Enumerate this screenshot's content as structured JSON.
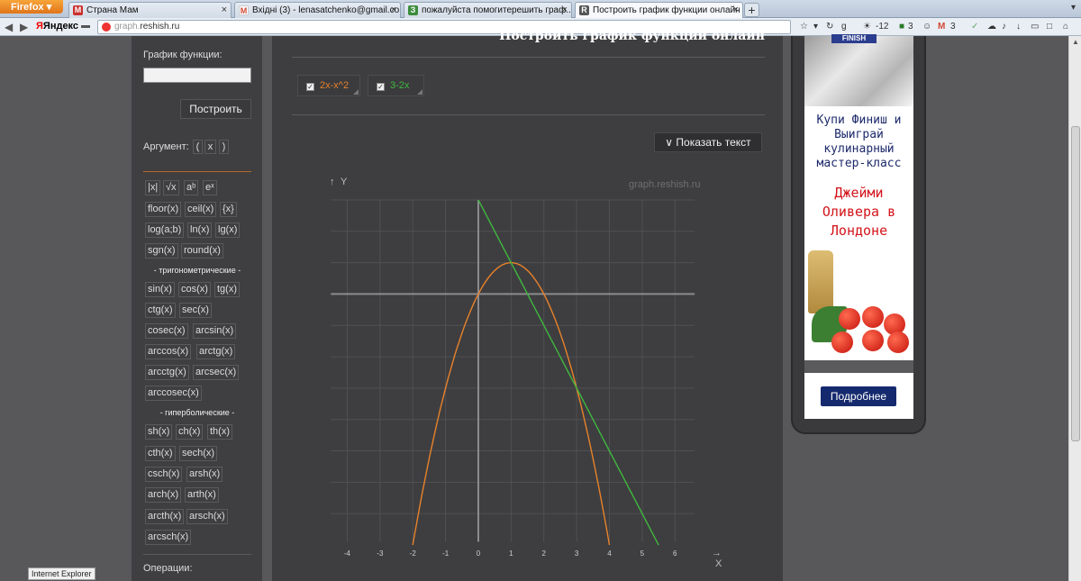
{
  "browser": {
    "menu_button": "Firefox",
    "tabs": [
      {
        "title": "Страна Мам",
        "icon": "М",
        "color": "#c9302c"
      },
      {
        "title": "Вхідні (3) - lenasatchenko@gmail.co...",
        "icon": "M",
        "color": "#d14836"
      },
      {
        "title": "пожалуйста помогитерешить граф...",
        "icon": "З",
        "color": "#3b8c3b"
      },
      {
        "title": "Построить график функции онлайн",
        "icon": "R",
        "color": "#555555"
      }
    ],
    "search_engine": "Яндекс",
    "url_prefix": "graph.",
    "url_host": "reshish.ru",
    "toolbar": {
      "weather": "-12",
      "count1": "3",
      "count2": "3"
    },
    "status_text": "Internet Explorer"
  },
  "sidebar": {
    "function_label": "График функции:",
    "build_button": "Построить",
    "argument_label": "Аргумент:",
    "arg_buttons": [
      "(",
      "x",
      ")"
    ],
    "trig_label": "- тригонометрические -",
    "hyper_label": "- гиперболические -",
    "operations_label": "Операции:",
    "basic": [
      "|x|",
      "√x",
      "aᵇ",
      "eˣ",
      "floor(x)",
      "ceil(x)",
      "{x}",
      "log(a;b)",
      "ln(x)",
      "lg(x)",
      "sgn(x)",
      "round(x)"
    ],
    "trig": [
      "sin(x)",
      "cos(x)",
      "tg(x)",
      "ctg(x)",
      "sec(x)",
      "cosec(x)",
      "arcsin(x)",
      "arccos(x)",
      "arctg(x)",
      "arcctg(x)",
      "arcsec(x)",
      "arccosec(x)"
    ],
    "hyper": [
      "sh(x)",
      "ch(x)",
      "th(x)",
      "cth(x)",
      "sech(x)",
      "csch(x)",
      "arsh(x)",
      "arch(x)",
      "arth(x)",
      "arcth(x)",
      "arsch(x)",
      "arcsch(x)"
    ]
  },
  "main": {
    "title": "Построить график функции онлайн",
    "functions": [
      {
        "label": "2x-x^2",
        "color": "#e8822a",
        "checked": true
      },
      {
        "label": "3-2x",
        "color": "#3fb83f",
        "checked": true
      }
    ],
    "show_text_button": "∨ Показать текст",
    "watermark": "graph.reshish.ru",
    "y_axis_label": "Y",
    "x_axis_label": "X"
  },
  "chart_data": {
    "type": "line",
    "title": "",
    "xlabel": "X",
    "ylabel": "Y",
    "xlim": [
      -4.7,
      6.9
    ],
    "ylim": [
      -8.0,
      3.2
    ],
    "x_ticks": [
      -4,
      -3,
      -2,
      -1,
      0,
      1,
      2,
      3,
      4,
      5,
      6
    ],
    "y_ticks": [
      3,
      2,
      1,
      0,
      -1,
      -2,
      -3,
      -4,
      -5,
      -6,
      -7
    ],
    "grid": true,
    "series": [
      {
        "name": "2x-x^2",
        "color": "#e8822a",
        "x_range": [
          -2,
          4
        ],
        "points": [
          [
            -2,
            -8
          ],
          [
            -1,
            -3
          ],
          [
            0,
            0
          ],
          [
            1,
            1
          ],
          [
            2,
            0
          ],
          [
            3,
            -3
          ],
          [
            4,
            -8
          ]
        ]
      },
      {
        "name": "3-2x",
        "color": "#3fb83f",
        "x_range": [
          0,
          5.5
        ],
        "points": [
          [
            0,
            3
          ],
          [
            1,
            1
          ],
          [
            2,
            -1
          ],
          [
            3,
            -3
          ],
          [
            4,
            -5
          ],
          [
            5,
            -7
          ],
          [
            5.5,
            -8
          ]
        ]
      }
    ]
  },
  "ad": {
    "brand": "FINISH",
    "line1": "Купи Финиш и Выиграй кулинарный мастер-класс",
    "line2": "Джейми Оливера в Лондоне",
    "button": "Подробнее"
  }
}
